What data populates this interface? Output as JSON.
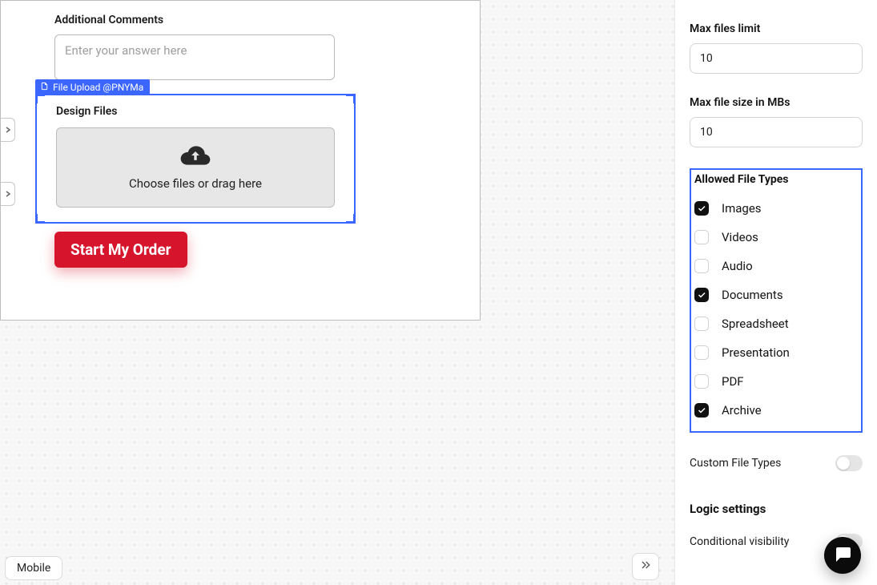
{
  "form": {
    "comments": {
      "label": "Additional Comments",
      "placeholder": "Enter your answer here"
    },
    "upload": {
      "selection_tag": "File Upload @PNYMa",
      "label": "Design Files",
      "dropzone_text": "Choose files or drag here"
    },
    "submit_label": "Start My Order"
  },
  "panel": {
    "max_files_label": "Max files limit",
    "max_files_value": "10",
    "max_size_label": "Max file size in MBs",
    "max_size_value": "10",
    "allowed_title": "Allowed File Types",
    "file_types": [
      {
        "label": "Images",
        "checked": true
      },
      {
        "label": "Videos",
        "checked": false
      },
      {
        "label": "Audio",
        "checked": false
      },
      {
        "label": "Documents",
        "checked": true
      },
      {
        "label": "Spreadsheet",
        "checked": false
      },
      {
        "label": "Presentation",
        "checked": false
      },
      {
        "label": "PDF",
        "checked": false
      },
      {
        "label": "Archive",
        "checked": true
      }
    ],
    "custom_types_label": "Custom File Types",
    "custom_types_on": false,
    "logic_title": "Logic settings",
    "cond_vis_label": "Conditional visibility",
    "cond_vis_on": false
  },
  "bottom": {
    "mobile_label": "Mobile"
  }
}
